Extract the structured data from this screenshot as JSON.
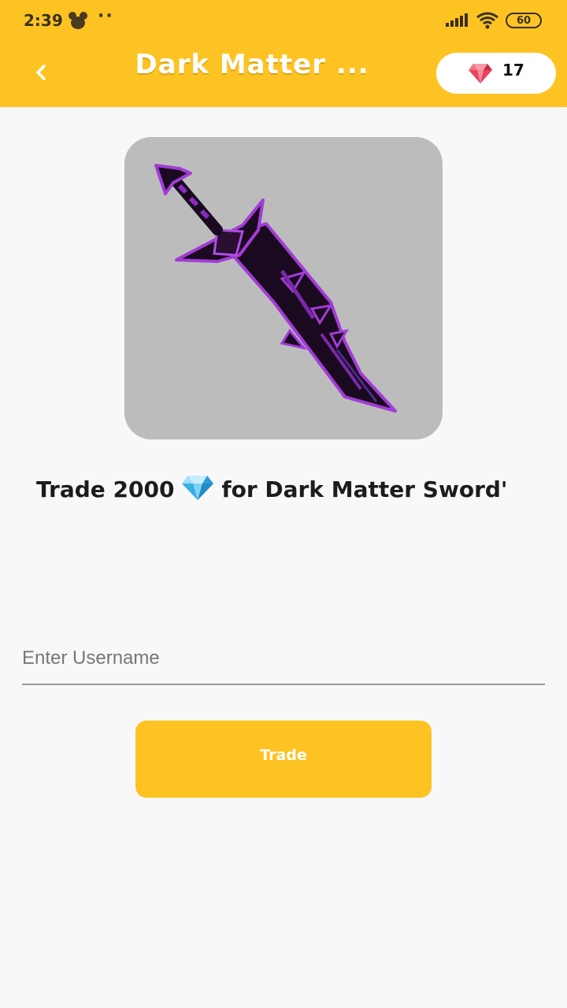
{
  "status_bar": {
    "time": "2:39",
    "battery": "60"
  },
  "app_bar": {
    "title": "Dark Matter ...",
    "gem_count": "17",
    "accent_color": "#fdc323"
  },
  "item": {
    "image_icon": "dark-matter-sword-image"
  },
  "trade_info": {
    "prefix": "Trade 2000",
    "suffix": "for Dark Matter Sword'"
  },
  "form": {
    "username_placeholder": "Enter Username",
    "username_value": ""
  },
  "actions": {
    "trade_label": "Trade"
  }
}
